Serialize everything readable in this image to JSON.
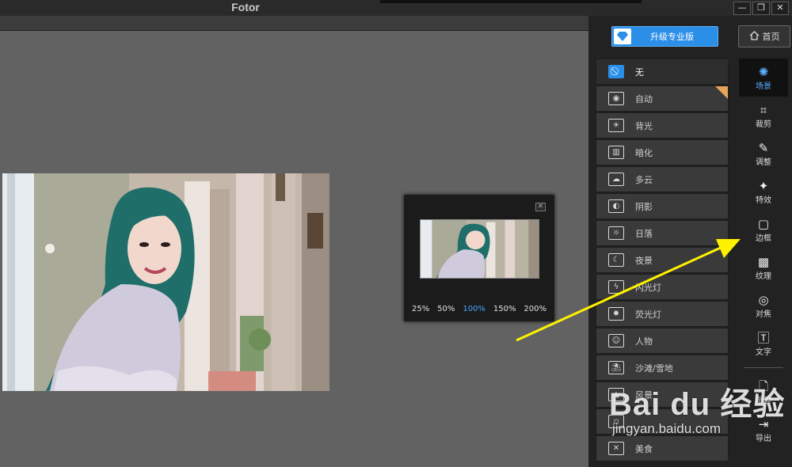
{
  "app": {
    "title": "Fotor"
  },
  "window_buttons": [
    "—",
    "❐",
    "✕"
  ],
  "toolbar": {
    "upgrade_label": "升级专业版",
    "home_label": "首页"
  },
  "preview": {
    "close_label": "✕",
    "zoom_levels": [
      "25%",
      "50%",
      "100%",
      "150%",
      "200%"
    ],
    "active_zoom": "100%"
  },
  "scenes": [
    {
      "label": "无",
      "icon": "ban-icon",
      "glyph": "⃠",
      "active": true
    },
    {
      "label": "自动",
      "icon": "camera-icon",
      "glyph": "◉"
    },
    {
      "label": "背光",
      "icon": "backlight-icon",
      "glyph": "☀"
    },
    {
      "label": "暗化",
      "icon": "darken-icon",
      "glyph": "▥"
    },
    {
      "label": "多云",
      "icon": "cloud-icon",
      "glyph": "☁"
    },
    {
      "label": "阴影",
      "icon": "shadow-icon",
      "glyph": "◐"
    },
    {
      "label": "日落",
      "icon": "sunset-icon",
      "glyph": "☼"
    },
    {
      "label": "夜景",
      "icon": "moon-icon",
      "glyph": "☾"
    },
    {
      "label": "闪光灯",
      "icon": "flash-icon",
      "glyph": "ϟ"
    },
    {
      "label": "荧光灯",
      "icon": "bulb-icon",
      "glyph": "✹"
    },
    {
      "label": "人物",
      "icon": "person-icon",
      "glyph": "☺"
    },
    {
      "label": "沙滩/雪地",
      "icon": "beach-icon",
      "glyph": "⛱"
    },
    {
      "label": "风景",
      "icon": "landscape-icon",
      "glyph": "▲"
    },
    {
      "label": "",
      "icon": "blank-icon",
      "glyph": "▫"
    },
    {
      "label": "美食",
      "icon": "food-icon",
      "glyph": "✕"
    }
  ],
  "tools": [
    {
      "label": "场景",
      "icon": "sun-icon",
      "glyph": "✺",
      "active": true
    },
    {
      "label": "裁剪",
      "icon": "crop-icon",
      "glyph": "⌗"
    },
    {
      "label": "调整",
      "icon": "pencil-icon",
      "glyph": "✎"
    },
    {
      "label": "特效",
      "icon": "sparkle-icon",
      "glyph": "✦"
    },
    {
      "label": "边框",
      "icon": "frame-icon",
      "glyph": "▢"
    },
    {
      "label": "纹理",
      "icon": "texture-icon",
      "glyph": "▩"
    },
    {
      "label": "对焦",
      "icon": "focus-icon",
      "glyph": "◎"
    },
    {
      "label": "文字",
      "icon": "text-icon",
      "glyph": "🅃"
    }
  ],
  "file_tools": [
    {
      "label": "新建",
      "icon": "new-file-icon",
      "glyph": "🗋"
    },
    {
      "label": "导出",
      "icon": "export-icon",
      "glyph": "⇥"
    }
  ],
  "watermark": {
    "brand": "Bai du 经验",
    "url": "jingyan.baidu.com"
  },
  "colors": {
    "accent": "#2b8fe8",
    "arrow": "#fff200",
    "active_zoom": "#4aa6ff"
  }
}
